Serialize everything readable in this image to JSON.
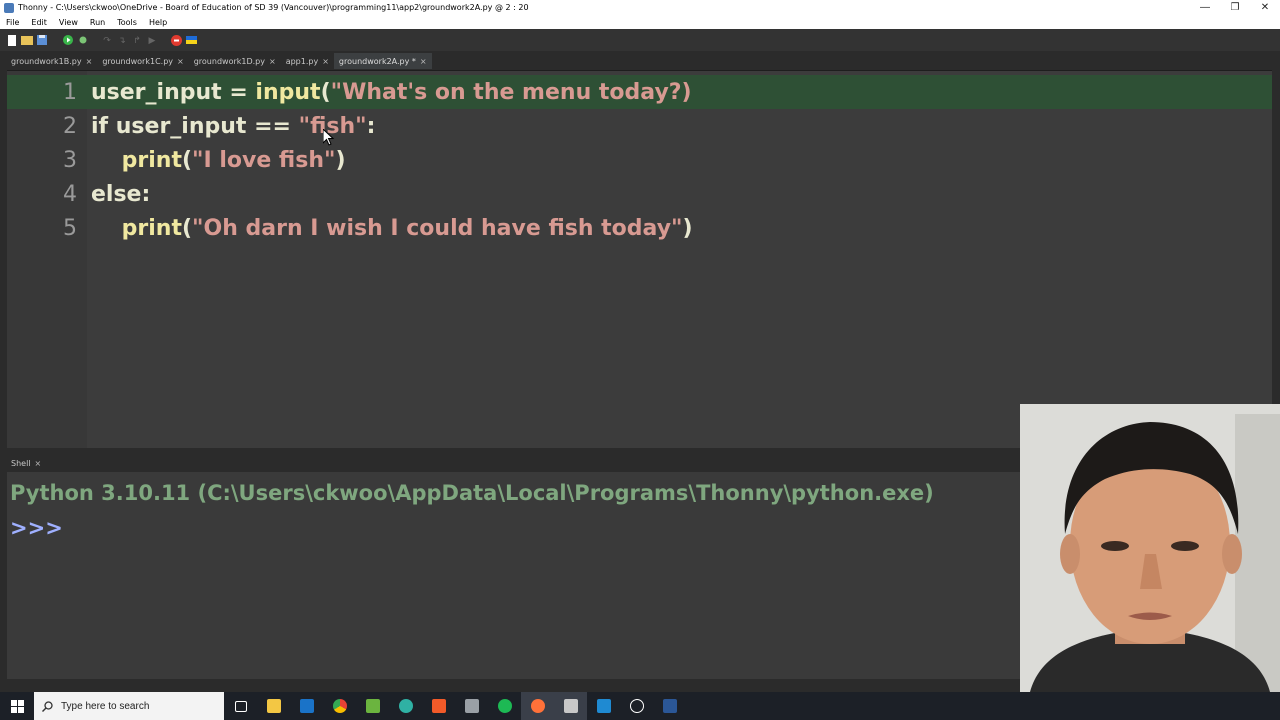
{
  "window": {
    "title": "Thonny - C:\\Users\\ckwoo\\OneDrive - Board of Education of SD 39 (Vancouver)\\programming11\\app2\\groundwork2A.py @ 2 : 20"
  },
  "menu": [
    "File",
    "Edit",
    "View",
    "Run",
    "Tools",
    "Help"
  ],
  "tabs": [
    {
      "label": "groundwork1B.py",
      "close": "×"
    },
    {
      "label": "groundwork1C.py",
      "close": "×"
    },
    {
      "label": "groundwork1D.py",
      "close": "×"
    },
    {
      "label": "app1.py",
      "close": "×"
    },
    {
      "label": "groundwork2A.py *",
      "close": "×"
    }
  ],
  "editor": {
    "lines": [
      {
        "num": "1",
        "parts": [
          "user_input = ",
          "input",
          "(",
          "\"What's on the menu today?)"
        ]
      },
      {
        "num": "2",
        "parts": [
          "if user_input == ",
          "\"fish\"",
          ":"
        ]
      },
      {
        "num": "3",
        "parts": [
          "    ",
          "print",
          "(",
          "\"I love fish\"",
          ")"
        ]
      },
      {
        "num": "4",
        "parts": [
          "else:"
        ]
      },
      {
        "num": "5",
        "parts": [
          "    ",
          "print",
          "(",
          "\"Oh darn I wish I could have fish today\"",
          ")"
        ]
      }
    ]
  },
  "shell": {
    "tab_label": "Shell",
    "tab_close": "×",
    "banner": "Python 3.10.11 (C:\\Users\\ckwoo\\AppData\\Local\\Programs\\Thonny\\python.exe)",
    "prompt": ">>>"
  },
  "taskbar": {
    "search_placeholder": "Type here to search",
    "apps": [
      {
        "icon": "task-view-icon",
        "color": "#ffffff"
      },
      {
        "icon": "file-explorer-icon",
        "color": "#f3c744"
      },
      {
        "icon": "outlook-icon",
        "color": "#1a73c8"
      },
      {
        "icon": "chrome-icon",
        "color": "#e84235"
      },
      {
        "icon": "notepad-plus-icon",
        "color": "#6bb43f"
      },
      {
        "icon": "edge-icon",
        "color": "#2fb1a4"
      },
      {
        "icon": "brave-icon",
        "color": "#f25a29"
      },
      {
        "icon": "camera-icon",
        "color": "#9aa0a6"
      },
      {
        "icon": "spotify-icon",
        "color": "#1db954"
      },
      {
        "icon": "firefox-icon",
        "color": "#ff7139"
      },
      {
        "icon": "thonny-icon",
        "color": "#c8c8c8"
      },
      {
        "icon": "vscode-icon",
        "color": "#1f8ad2"
      },
      {
        "icon": "media-player-icon",
        "color": "#ffffff"
      },
      {
        "icon": "word-icon",
        "color": "#2b5797"
      }
    ]
  },
  "colors": {
    "editor_bg": "#3c3c3c",
    "current_line": "#2e5035",
    "string": "#d89a92",
    "builtin": "#f0e8a0",
    "shell_banner": "#7fa77f",
    "shell_prompt": "#9fb0ff"
  }
}
